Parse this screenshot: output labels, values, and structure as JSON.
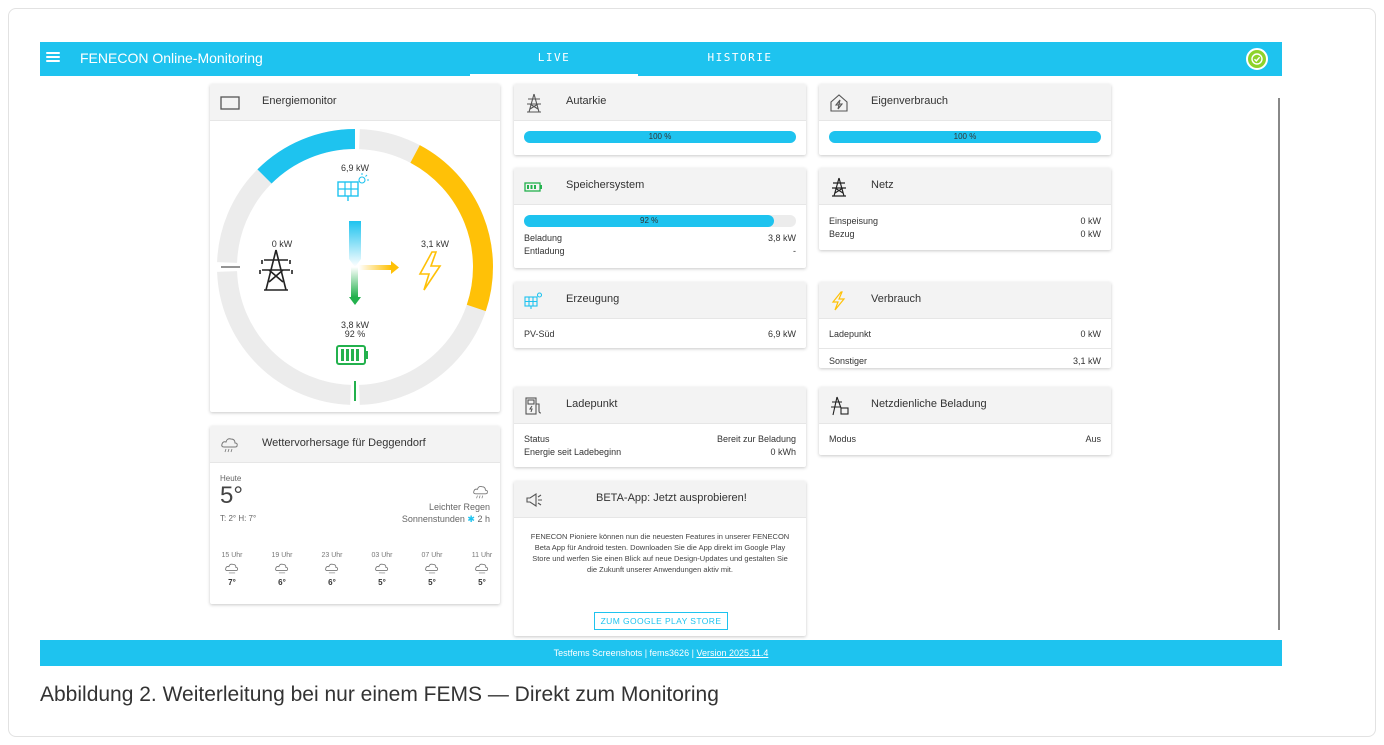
{
  "header": {
    "app_title": "FENECON Online-Monitoring",
    "tabs": [
      {
        "label": "LIVE"
      },
      {
        "label": "HISTORIE"
      }
    ],
    "accent_color": "#1ec3ef"
  },
  "energiemonitor": {
    "title": "Energiemonitor",
    "pv_value": "6,9 kW",
    "grid_value": "0 kW",
    "consumption_value": "3,1 kW",
    "storage_value": "3,8 kW",
    "storage_soc": "92 %",
    "pv_fill_fraction": 0.25,
    "consumption_fill_fraction": 0.2
  },
  "weather": {
    "title": "Wettervorhersage für Deggendorf",
    "day": "Heute",
    "temperature": "5°",
    "minmax": "T: 2° H: 7°",
    "condition": "Leichter Regen",
    "sun_hours_label": "Sonnenstunden",
    "sun_hours_value": "2 h",
    "forecast": [
      {
        "time": "15 Uhr",
        "temp": "7°"
      },
      {
        "time": "19 Uhr",
        "temp": "6°"
      },
      {
        "time": "23 Uhr",
        "temp": "6°"
      },
      {
        "time": "03 Uhr",
        "temp": "5°"
      },
      {
        "time": "07 Uhr",
        "temp": "5°"
      },
      {
        "time": "11 Uhr",
        "temp": "5°"
      }
    ]
  },
  "autarkie": {
    "title": "Autarkie",
    "value": "100 %",
    "fraction": 1.0
  },
  "eigenverbrauch": {
    "title": "Eigenverbrauch",
    "value": "100 %",
    "fraction": 1.0
  },
  "speicher": {
    "title": "Speichersystem",
    "value": "92 %",
    "fraction": 0.92,
    "rows": [
      {
        "label": "Beladung",
        "value": "3,8 kW"
      },
      {
        "label": "Entladung",
        "value": "-"
      }
    ]
  },
  "netz": {
    "title": "Netz",
    "rows": [
      {
        "label": "Einspeisung",
        "value": "0 kW"
      },
      {
        "label": "Bezug",
        "value": "0 kW"
      }
    ]
  },
  "erzeugung": {
    "title": "Erzeugung",
    "rows": [
      {
        "label": "PV-Süd",
        "value": "6,9 kW"
      }
    ]
  },
  "verbrauch": {
    "title": "Verbrauch",
    "rows": [
      {
        "label": "Ladepunkt",
        "value": "0 kW"
      },
      {
        "label": "Sonstiger",
        "value": "3,1 kW"
      }
    ]
  },
  "ladepunkt": {
    "title": "Ladepunkt",
    "rows": [
      {
        "label": "Status",
        "value": "Bereit zur Beladung"
      },
      {
        "label": "Energie seit Ladebeginn",
        "value": "0 kWh"
      }
    ]
  },
  "netzdienlich": {
    "title": "Netzdienliche Beladung",
    "rows": [
      {
        "label": "Modus",
        "value": "Aus"
      }
    ]
  },
  "beta": {
    "title": "BETA-App: Jetzt ausprobieren!",
    "text": "FENECON Pioniere können nun die neuesten Features in unserer FENECON Beta App für Android testen. Downloaden Sie die App direkt im Google Play Store und werfen Sie einen Blick auf neue Design-Updates und gestalten Sie die Zukunft unserer Anwendungen aktiv mit.",
    "button": "ZUM GOOGLE PLAY STORE"
  },
  "footer": {
    "prefix": "Testfems Screenshots | fems3626 |",
    "version_link": "Version 2025.11.4"
  },
  "caption": "Abbildung 2. Weiterleitung bei nur einem FEMS — Direkt zum Monitoring"
}
